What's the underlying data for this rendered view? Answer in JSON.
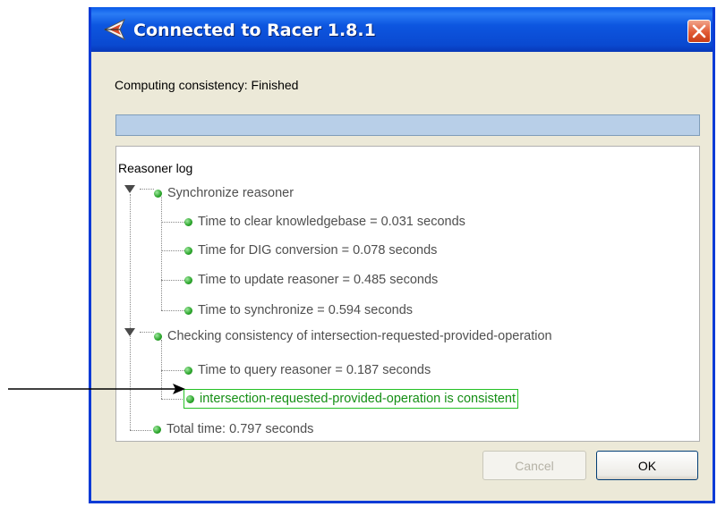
{
  "window": {
    "title": "Connected to Racer 1.8.1",
    "status_text": "Computing consistency: Finished",
    "progress": 1.0,
    "colors": {
      "title_bar": "#0a5ae8",
      "progress_fill": "#b8cfe8",
      "highlight": "#25c125"
    }
  },
  "log": {
    "header": "Reasoner log",
    "groups": [
      {
        "label": "Synchronize reasoner",
        "expanded": true,
        "children": [
          "Time to clear knowledgebase = 0.031 seconds",
          "Time for DIG conversion = 0.078 seconds",
          "Time to update reasoner = 0.485 seconds",
          "Time to synchronize = 0.594 seconds"
        ]
      },
      {
        "label": "Checking consistency of intersection-requested-provided-operation",
        "expanded": true,
        "children": [
          "Time to query reasoner = 0.187 seconds",
          "intersection-requested-provided-operation is consistent"
        ]
      }
    ],
    "total": "Total time: 0.797 seconds"
  },
  "buttons": {
    "cancel": "Cancel",
    "ok": "OK"
  },
  "icons": {
    "app": "racer-icon",
    "close": "close-icon",
    "node": "green-dot-icon",
    "expand": "expanded-triangle-icon"
  }
}
